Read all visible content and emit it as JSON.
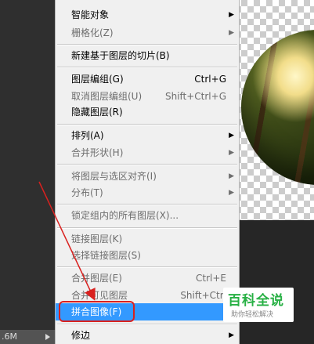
{
  "status_bar": {
    "text": ".6M"
  },
  "menu": {
    "items": [
      {
        "label": "智能对象",
        "shortcut": "",
        "submenu": true,
        "disabled": false
      },
      {
        "label": "栅格化(Z)",
        "shortcut": "",
        "submenu": true,
        "disabled": true
      },
      {
        "label": "新建基于图层的切片(B)",
        "shortcut": "",
        "submenu": false,
        "disabled": false
      },
      {
        "label": "图层编组(G)",
        "shortcut": "Ctrl+G",
        "submenu": false,
        "disabled": false
      },
      {
        "label": "取消图层编组(U)",
        "shortcut": "Shift+Ctrl+G",
        "submenu": false,
        "disabled": true
      },
      {
        "label": "隐藏图层(R)",
        "shortcut": "",
        "submenu": false,
        "disabled": false
      },
      {
        "label": "排列(A)",
        "shortcut": "",
        "submenu": true,
        "disabled": false
      },
      {
        "label": "合并形状(H)",
        "shortcut": "",
        "submenu": true,
        "disabled": true
      },
      {
        "label": "将图层与选区对齐(I)",
        "shortcut": "",
        "submenu": true,
        "disabled": true
      },
      {
        "label": "分布(T)",
        "shortcut": "",
        "submenu": true,
        "disabled": true
      },
      {
        "label": "锁定组内的所有图层(X)...",
        "shortcut": "",
        "submenu": false,
        "disabled": true
      },
      {
        "label": "链接图层(K)",
        "shortcut": "",
        "submenu": false,
        "disabled": true
      },
      {
        "label": "选择链接图层(S)",
        "shortcut": "",
        "submenu": false,
        "disabled": true
      },
      {
        "label": "合并图层(E)",
        "shortcut": "Ctrl+E",
        "submenu": false,
        "disabled": true
      },
      {
        "label": "合并可见图层",
        "shortcut": "Shift+Ctrl",
        "submenu": false,
        "disabled": true
      },
      {
        "label": "拼合图像(F)",
        "shortcut": "",
        "submenu": false,
        "disabled": false,
        "highlighted": true
      },
      {
        "label": "修边",
        "shortcut": "",
        "submenu": true,
        "disabled": false
      }
    ]
  },
  "watermark": {
    "title": "百科全说",
    "subtitle": "助你轻松解决"
  },
  "colors": {
    "highlight": "#3399ff",
    "annotation_red": "#d9211f",
    "watermark_green": "#27b044"
  }
}
